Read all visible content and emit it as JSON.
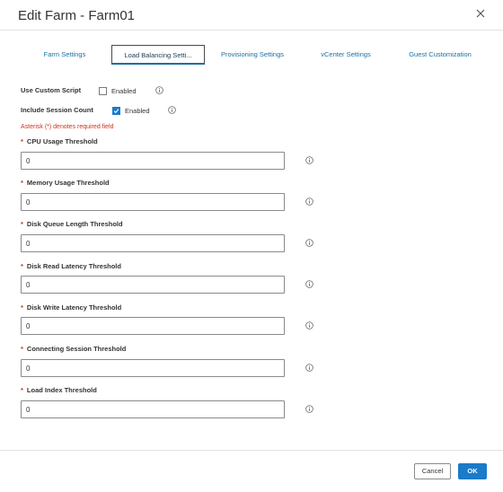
{
  "dialog": {
    "title": "Edit Farm - Farm01",
    "close_icon": "close-icon"
  },
  "tabs": [
    {
      "label": "Farm Settings",
      "active": false
    },
    {
      "label": "Load Balancing Setti...",
      "active": true
    },
    {
      "label": "Provisioning Settings",
      "active": false
    },
    {
      "label": "vCenter Settings",
      "active": false
    },
    {
      "label": "Guest Customization",
      "active": false
    }
  ],
  "options": {
    "custom_script": {
      "label": "Use Custom Script",
      "checkbox_label": "Enabled",
      "checked": false
    },
    "session_count": {
      "label": "Include Session Count",
      "checkbox_label": "Enabled",
      "checked": true
    }
  },
  "required_note": "Asterisk (*) denotes required field",
  "fields": [
    {
      "label": "CPU Usage Threshold",
      "value": "0"
    },
    {
      "label": "Memory Usage Threshold",
      "value": "0"
    },
    {
      "label": "Disk Queue Length Threshold",
      "value": "0"
    },
    {
      "label": "Disk Read Latency Threshold",
      "value": "0"
    },
    {
      "label": "Disk Write Latency Threshold",
      "value": "0"
    },
    {
      "label": "Connecting Session Threshold",
      "value": "0"
    },
    {
      "label": "Load Index Threshold",
      "value": "0"
    }
  ],
  "required_marker": "*",
  "footer": {
    "cancel_label": "Cancel",
    "ok_label": "OK"
  },
  "colors": {
    "accent": "#1a7bc9",
    "link": "#1a6fa3",
    "required": "#d4301a"
  }
}
